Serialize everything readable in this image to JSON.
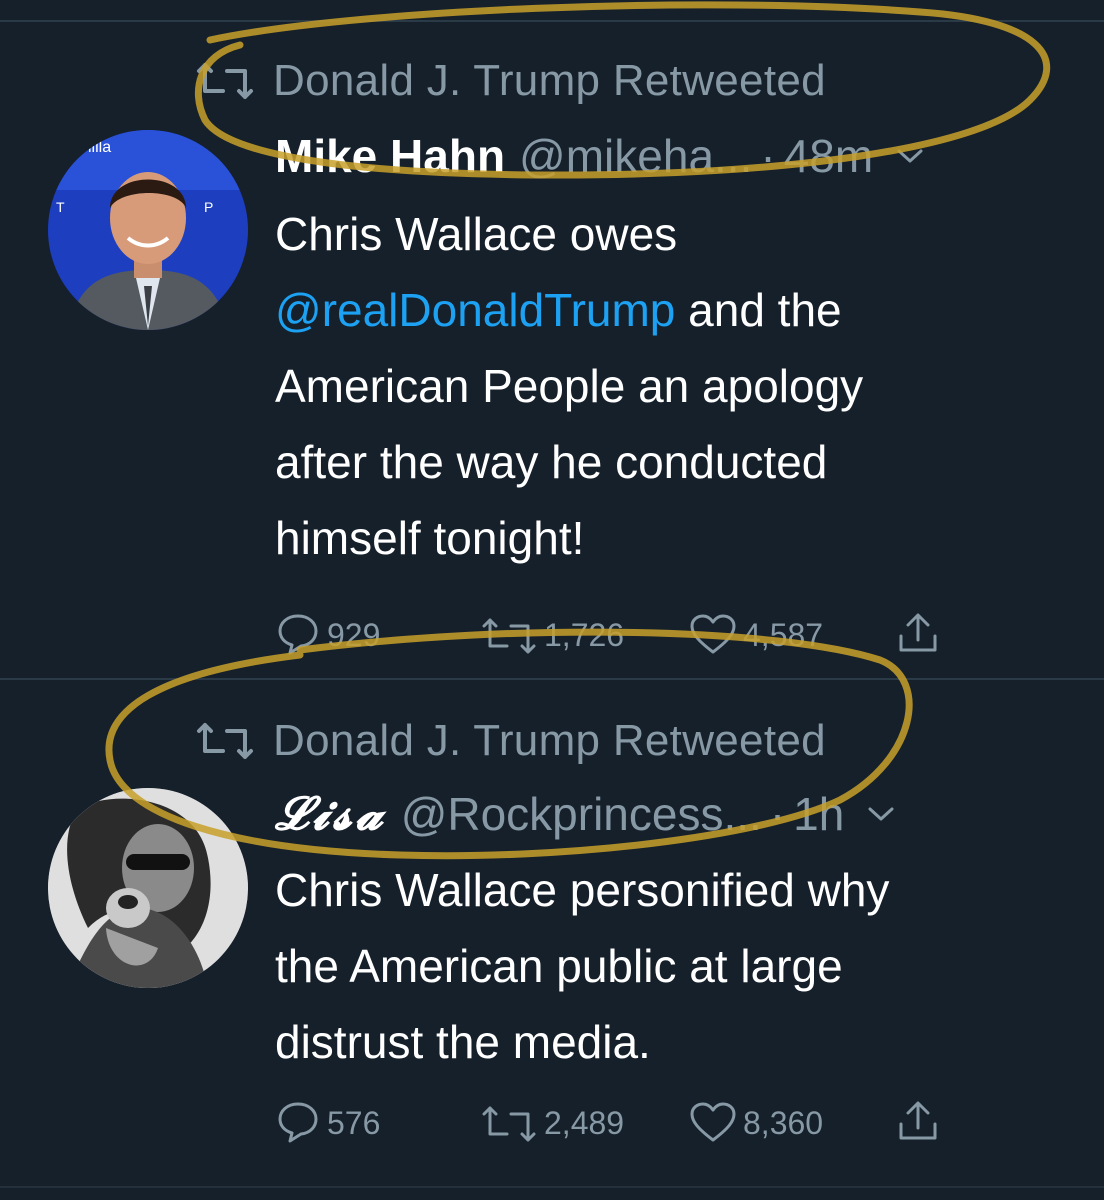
{
  "tweets": [
    {
      "retweeted_by": "Donald J. Trump Retweeted",
      "name": "Mike Hahn",
      "handle": "@mikeha...",
      "dot": "·",
      "time": "48m",
      "text_line_1": "Chris Wallace owes",
      "mention": "@realDonaldTrump",
      "text_after_mention": " and the",
      "text_rest": "American People an apology\nafter the way he conducted\nhimself tonight!",
      "replies": "929",
      "retweets": "1,726",
      "likes": "4,587"
    },
    {
      "retweeted_by": "Donald J. Trump Retweeted",
      "name": "𝓛𝓲𝓼𝓪",
      "handle": "@Rockprincess...",
      "dot": "·",
      "time": "1h",
      "text": "Chris Wallace personified why\nthe American public at large\ndistrust the media.",
      "replies": "576",
      "retweets": "2,489",
      "likes": "8,360"
    }
  ],
  "colors": {
    "background": "#15202b",
    "muted": "#8899a6",
    "link": "#1da1f2",
    "highlight": "#c8a02a"
  }
}
